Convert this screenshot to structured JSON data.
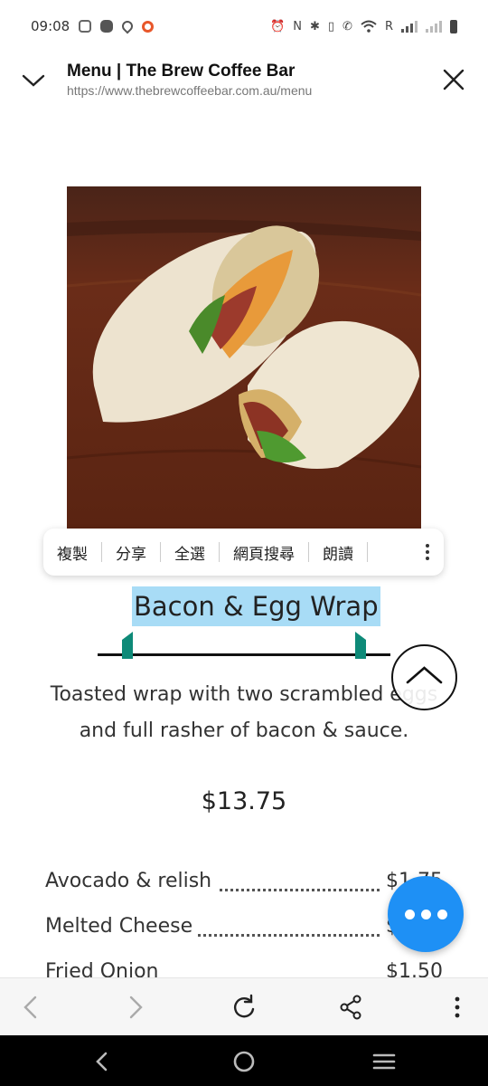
{
  "status_bar": {
    "time": "09:08",
    "carrier_indicator": "R"
  },
  "header": {
    "title": "Menu | The Brew Coffee Bar",
    "url": "https://www.thebrewcoffeebar.com.au/menu"
  },
  "image": {
    "subject": "bacon-egg-wrap-photo"
  },
  "context_menu": {
    "items": [
      "複製",
      "分享",
      "全選",
      "網頁搜尋",
      "朗讀"
    ]
  },
  "item": {
    "title": "Bacon & Egg Wrap",
    "description_line1": "Toasted wrap with two scrambled eggs",
    "description_line2": "and full rasher of bacon & sauce.",
    "price": "$13.75"
  },
  "addons": [
    {
      "name": "Avocado & relish",
      "price": "$1.75"
    },
    {
      "name": "Melted Cheese",
      "price": "$1.50"
    },
    {
      "name": "Fried Onion",
      "price": "$1.50"
    }
  ],
  "colors": {
    "accent": "#1e90f5",
    "selection": "#a8dcf6",
    "handle": "#0e8a78"
  }
}
